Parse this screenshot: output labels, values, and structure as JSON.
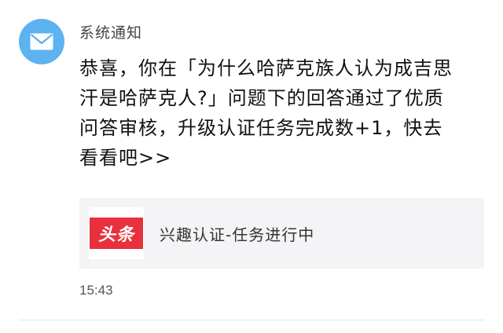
{
  "notification": {
    "sender": "系统通知",
    "avatar_icon": "envelope-icon",
    "message_lines": [
      "恭喜，你在「为什么哈萨克族人认为成吉思",
      "汗是哈萨克人?」问题下的回答通过了优质",
      "问答审核，升级认证任务完成数+1，快去",
      "看看吧>>"
    ],
    "card": {
      "logo_text": "头条",
      "title": "兴趣认证-任务进行中"
    },
    "time": "15:43"
  },
  "colors": {
    "avatar_bg": "#5db2f0",
    "logo_red": "#e8313d",
    "card_bg": "#f4f4f6"
  }
}
